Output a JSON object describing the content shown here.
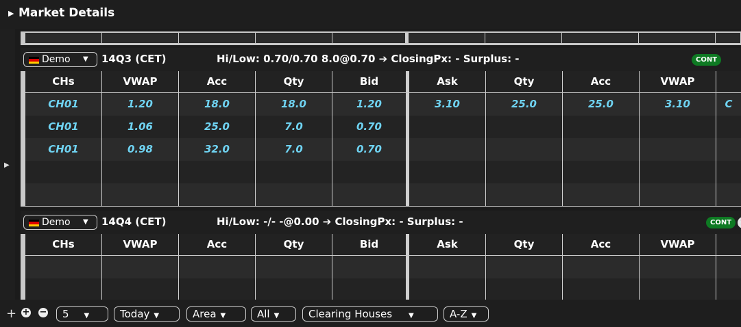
{
  "panel": {
    "title": "Market Details",
    "expand_icon": "triangle-right-icon",
    "side_expand_icon": "triangle-right-icon"
  },
  "colors": {
    "cyan_value": "#6fd3f2",
    "cont_badge": "#0e7a23",
    "highlight": "#ffee00"
  },
  "columns": [
    "CHs",
    "VWAP",
    "Acc",
    "Qty",
    "Bid",
    "Ask",
    "Qty",
    "Acc",
    "VWAP",
    ""
  ],
  "contracts": [
    {
      "market": "Demo",
      "contract": "14Q3 (CET)",
      "info": "Hi/Low: 0.70/0.70  8.0@0.70 ➔ ClosingPx: - Surplus: -",
      "badge": "CONT",
      "rows": [
        [
          "CH01",
          "1.20",
          "18.0",
          "18.0",
          "1.20",
          "3.10",
          "25.0",
          "25.0",
          "3.10",
          "C"
        ],
        [
          "CH01",
          "1.06",
          "25.0",
          "7.0",
          "0.70",
          "",
          "",
          "",
          "",
          ""
        ],
        [
          "CH01",
          "0.98",
          "32.0",
          "7.0",
          "0.70",
          "",
          "",
          "",
          "",
          ""
        ],
        [
          "",
          "",
          "",
          "",
          "",
          "",
          "",
          "",
          "",
          ""
        ],
        [
          "",
          "",
          "",
          "",
          "",
          "",
          "",
          "",
          "",
          ""
        ]
      ]
    },
    {
      "market": "Demo",
      "contract": "14Q4 (CET)",
      "info": "Hi/Low: -/-  -@0.00 ➔ ClosingPx: - Surplus: -",
      "badge": "CONT",
      "rows": [
        [
          "",
          "",
          "",
          "",
          "",
          "",
          "",
          "",
          "",
          ""
        ],
        [
          "",
          "",
          "",
          "",
          "",
          "",
          "",
          "",
          "",
          ""
        ]
      ]
    }
  ],
  "footer": {
    "plus": "+",
    "add_icon": "plus-circle-icon",
    "remove_icon": "minus-circle-icon",
    "rows_select": "5",
    "period_select": "Today",
    "area_select": "Area",
    "filter_select": "All",
    "group_select": "Clearing Houses",
    "sort_select": "A-Z"
  }
}
